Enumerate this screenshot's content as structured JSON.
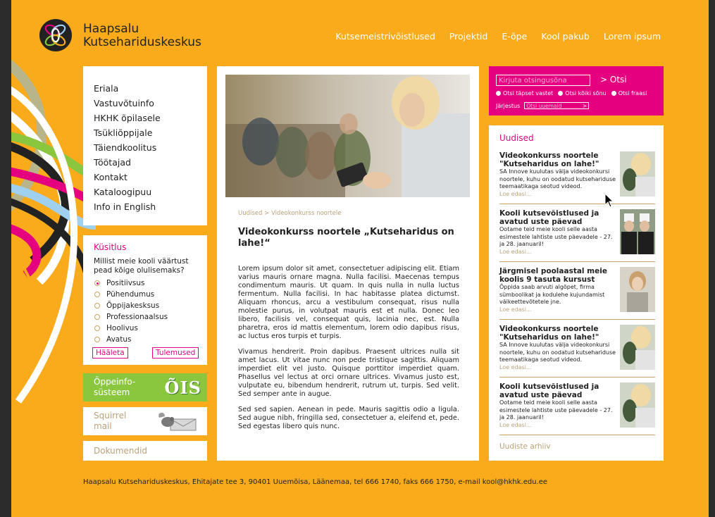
{
  "brand": {
    "line1": "Haapsalu",
    "line2": "Kutsehariduskeskus"
  },
  "topnav": [
    "Kutsemeistrivõistlused",
    "Projektid",
    "E-õpe",
    "Kool pakub",
    "Lorem ipsum"
  ],
  "sidebar": {
    "menu": [
      "Eriala",
      "Vastuvõtuinfo",
      "HKHK õpilasele",
      "Tsükliõppijale",
      "Täiendkoolitus",
      "Töötajad",
      "Kontakt",
      "Kataloogipuu",
      "Info in English"
    ],
    "poll": {
      "title": "Küsitlus",
      "question": "Millist meie kooli väärtust pead kõige olulisemaks?",
      "options": [
        "Positiivsus",
        "Pühendumus",
        "Õppijakesksus",
        "Professionaalsus",
        "Hoolivus",
        "Avatus"
      ],
      "selected": 0,
      "vote_label": "Hääleta",
      "results_label": "Tulemused"
    },
    "ois": {
      "label": "Õppeinfo-süsteem",
      "logo": "ÕIS"
    },
    "squirrel": {
      "label": "Squirrel mail"
    },
    "documents": {
      "label": "Dokumendid"
    }
  },
  "article": {
    "breadcrumb": "Uudised > Videokonkurss noortele",
    "title": "Videokonkurss noortele „Kutseharidus on lahe!“",
    "paragraphs": [
      "Lorem ipsum dolor sit amet, consectetuer adipiscing elit. Etiam varius mauris ornare magna. Nulla facilisi. Maecenas tempus condimentum mauris. Ut quam. In quis nulla in nulla luctus fermentum. Nulla facilisi. In hac habitasse platea dictumst. Aliquam rhoncus, arcu a vestibulum consequat, risus nulla molestie purus, in volutpat mauris est et nulla. Donec leo libero, facilisis vel, consequat quis, lacinia nec, est. Nulla pharetra, eros id mattis elementum, lorem odio dapibus risus, ac luctus eros turpis et turpis.",
      "Vivamus hendrerit. Proin dapibus. Praesent ultrices nulla sit amet lacus. Ut vitae nunc non pede tristique sagittis. Aliquam imperdiet elit vel justo. Quisque porttitor imperdiet quam. Phasellus vel lectus at orci ornare ultrices. Vivamus justo est, vulputate eu, bibendum hendrerit, rutrum ut, turpis. Sed velit. Sed semper ante in augue.",
      "Sed sed sapien. Aenean in pede. Mauris sagittis odio a ligula. Sed augue nibh, fringilla sed, consectetuer a, eleifend et, pede. Sed egestas libero quis nunc."
    ]
  },
  "search": {
    "placeholder": "Kirjuta otsingusõna",
    "button": "> Otsi",
    "options": [
      "Otsi täpset vastet",
      "Otsi kõiki sõnu",
      "Otsi fraasi"
    ],
    "selected": 0,
    "sort_label": "Järjestus",
    "sort_value": "Otsi uuemaid",
    "sort_arrow": ">"
  },
  "news": {
    "title": "Uudised",
    "items": [
      {
        "title": "Videokonkurss noortele \"Kutseharidus on lahe!\"",
        "text": "SA Innove kuulutas välja videokonkursi noortele, kuhu on oodatud kutsehariduse teemaatikaga seotud videod.",
        "more": "Loe edasi..."
      },
      {
        "title": "Kooli kutsevõistlused ja avatud uste päevad",
        "text": "Ootame teid meie kooli selle aasta esimestele lahtiste uste päevadele - 27. ja 28. jaanuaril!",
        "more": "Loe edasi..."
      },
      {
        "title": "Järgmisel poolaastal meie koolis 9 tasuta kursust",
        "text": "Õppida saab arvuti algõpet, firma sümboolikat ja kodulehe kujundamist väikeettevõtetele jne.",
        "more": "Loe edasi..."
      },
      {
        "title": "Videokonkurss noortele \"Kutseharidus on lahe!\"",
        "text": "SA Innove kuulutas välja videokonkursi noortele, kuhu on oodatud kutsehariduse teemaatikaga seotud videod.",
        "more": "Loe edasi..."
      },
      {
        "title": "Kooli kutsevõistlused ja avatud uste päevad",
        "text": "Ootame teid meie kooli selle aasta esimestele lahtiste uste päevadele - 27. ja 28. jaanuaril!",
        "more": "Loe edasi..."
      }
    ],
    "archive": "Uudiste arhiiv"
  },
  "footer": "Haapsalu Kutsehariduskeskus, Ehitajate tee 3, 90401 Uuemõisa, Läänemaa, tel 666 1740, faks 666 1750, e-mail kool@hkhk.edu.ee",
  "colors": {
    "background": "#f9ab1b",
    "accent": "#e4007f",
    "green": "#8bc63f",
    "muted": "#b9a27a"
  }
}
